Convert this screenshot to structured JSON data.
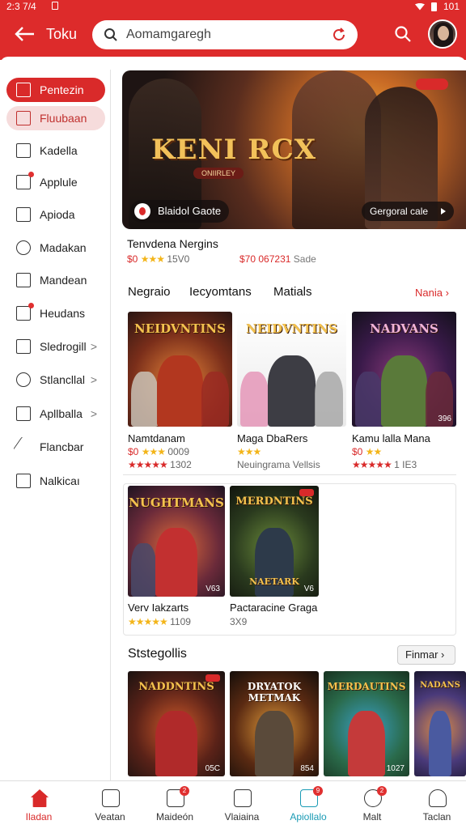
{
  "status": {
    "time": "2:3 7/4",
    "right_text": "101"
  },
  "header": {
    "title": "Toku",
    "search_value": "Aomamgaregh"
  },
  "sidebar": {
    "items": [
      {
        "label": "Pentezin",
        "icon": "edit-icon"
      },
      {
        "label": "Fluubaan",
        "icon": "mail-icon"
      },
      {
        "label": "Kadella",
        "icon": "calendar-icon"
      },
      {
        "label": "Applule",
        "icon": "mail-badge-icon"
      },
      {
        "label": "Apioda",
        "icon": "square-icon"
      },
      {
        "label": "Madakan",
        "icon": "slash-icon"
      },
      {
        "label": "Mandean",
        "icon": "inbox-icon"
      },
      {
        "label": "Heudans",
        "icon": "mail-badge-icon"
      },
      {
        "label": "Sledrogill",
        "icon": "box-icon",
        "chevron": ">"
      },
      {
        "label": "Stlancllal",
        "icon": "gear-icon",
        "chevron": ">"
      },
      {
        "label": "Apllballa",
        "icon": "list-icon",
        "chevron": ">"
      },
      {
        "label": "Flancbar",
        "icon": "pen-icon"
      },
      {
        "label": "Nalkicaı",
        "icon": "doc-icon"
      }
    ]
  },
  "hero": {
    "title": "KENI RCX",
    "subtitle": "ONIIRLEY",
    "brand": "Blaidol Gaote",
    "cta": "Gergoral cale"
  },
  "featured": {
    "name": "Tenvdena Nergins",
    "price": "$0",
    "stars": "★★★",
    "rating_text": "15V0",
    "sales_price": "$70",
    "sales_value": "067231",
    "sales_label": "Sade"
  },
  "tabs": [
    "Negraio",
    "Iecyomtans",
    "Matials"
  ],
  "tabs_more": "Nania ›",
  "row1": [
    {
      "title": "NEIDVNTINS",
      "name": "Namtdanam",
      "price": "$0",
      "stars": "★★★",
      "meta": "0009",
      "rstars": "★★★★★",
      "rating": "1302"
    },
    {
      "title": "NEIDVNTINS",
      "name": "Maga DbaRers",
      "price": "",
      "stars": "★★★",
      "meta": "",
      "rstars": "",
      "rating": "Neuingrama Vellsis"
    },
    {
      "title": "NADVANS",
      "name": "Kamu lalla Mana",
      "price": "$0",
      "stars": "★★",
      "meta": "",
      "rstars": "★★★★★",
      "rating": "1 IE3",
      "count": "396"
    }
  ],
  "row2": [
    {
      "title": "NUGHTMANS",
      "name": "Verv Iakzarts",
      "price": "",
      "stars": "★★★★★",
      "meta": "1109",
      "rstars": "",
      "rating": "",
      "count": "V63"
    },
    {
      "title": "MERDNTINS",
      "sub": "NAETARK",
      "name": "Pactaracine Graga",
      "price": "",
      "stars": "",
      "meta": "",
      "rstars": "",
      "rating": "3X9",
      "count": "V6"
    }
  ],
  "section2": {
    "title": "Ststegollis",
    "button": "Finmar ›"
  },
  "row3": [
    {
      "title": "NADDNTINS",
      "count": "05C"
    },
    {
      "title": "DRYATOK METMAK",
      "count": "854"
    },
    {
      "title": "MERDAUTINS",
      "count": "1027"
    },
    {
      "title": "NADANS",
      "count": ""
    }
  ],
  "bottomnav": [
    {
      "label": "Iladan",
      "active": true
    },
    {
      "label": "Veatan"
    },
    {
      "label": "Maideón",
      "badge": "2"
    },
    {
      "label": "Vlaiaina"
    },
    {
      "label": "Apiollalo",
      "badge": "9"
    },
    {
      "label": "Malt",
      "badge": "2"
    },
    {
      "label": "Taclan"
    }
  ],
  "colors": {
    "brand": "#dd2b2b",
    "accent_teal": "#1a9bb5",
    "star": "#f3b51a"
  }
}
